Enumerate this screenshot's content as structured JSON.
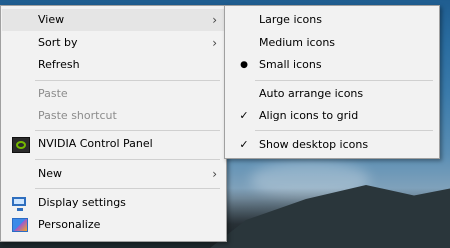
{
  "context_menu": {
    "items": [
      {
        "label": "View"
      },
      {
        "label": "Sort by"
      },
      {
        "label": "Refresh"
      },
      {
        "label": "Paste"
      },
      {
        "label": "Paste shortcut"
      },
      {
        "label": "NVIDIA Control Panel"
      },
      {
        "label": "New"
      },
      {
        "label": "Display settings"
      },
      {
        "label": "Personalize"
      }
    ],
    "submenu_arrow": "›"
  },
  "view_submenu": {
    "items": [
      {
        "label": "Large icons"
      },
      {
        "label": "Medium icons"
      },
      {
        "label": "Small icons"
      },
      {
        "label": "Auto arrange icons"
      },
      {
        "label": "Align icons to grid"
      },
      {
        "label": "Show desktop icons"
      }
    ],
    "bullet": "●",
    "check": "✓"
  },
  "icons": {
    "nvidia": "nvidia-control-panel-icon",
    "display": "display-settings-icon",
    "personalize": "personalize-icon"
  },
  "colors": {
    "menu_bg": "#f2f2f2",
    "highlight": "#e5e5e5",
    "disabled_text": "#8c8c8c",
    "nvidia_green": "#76b900"
  }
}
